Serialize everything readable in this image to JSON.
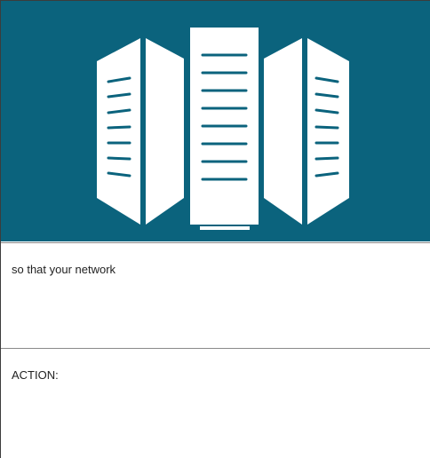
{
  "hero": {
    "icon": "server-racks-icon",
    "background_color": "#0b637d",
    "icon_color": "#ffffff",
    "slot_color": "#0b637d"
  },
  "sections": [
    {
      "text": "so that your network"
    },
    {
      "text": "ACTION:"
    }
  ]
}
